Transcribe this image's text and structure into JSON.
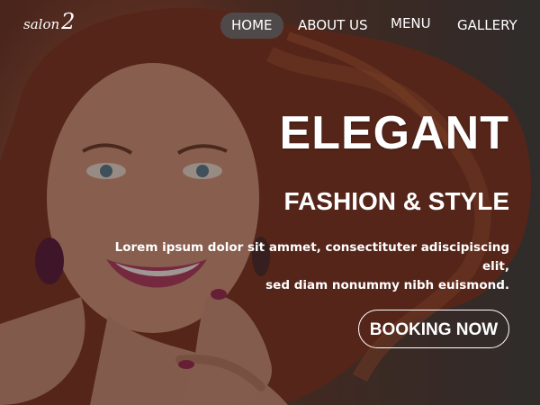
{
  "brand": {
    "logo_word": "salon",
    "logo_number": "2"
  },
  "nav": {
    "items": [
      "HOME",
      "ABOUT US",
      "MENU",
      "GALLERY"
    ],
    "active": "HOME"
  },
  "hero": {
    "headline": "ELEGANT",
    "subheadline": "FASHION & STYLE",
    "description_line1": "Lorem ipsum dolor sit ammet, consectituter adiscipiscing elit,",
    "description_line2": "sed diam nonummy nibh euismond.",
    "cta_label": "BOOKING NOW"
  },
  "colors": {
    "hair": "#8a3a22",
    "skin": "#d79c84",
    "overlay": "#140e0c",
    "text": "#ffffff",
    "nav_active": "#505052"
  }
}
